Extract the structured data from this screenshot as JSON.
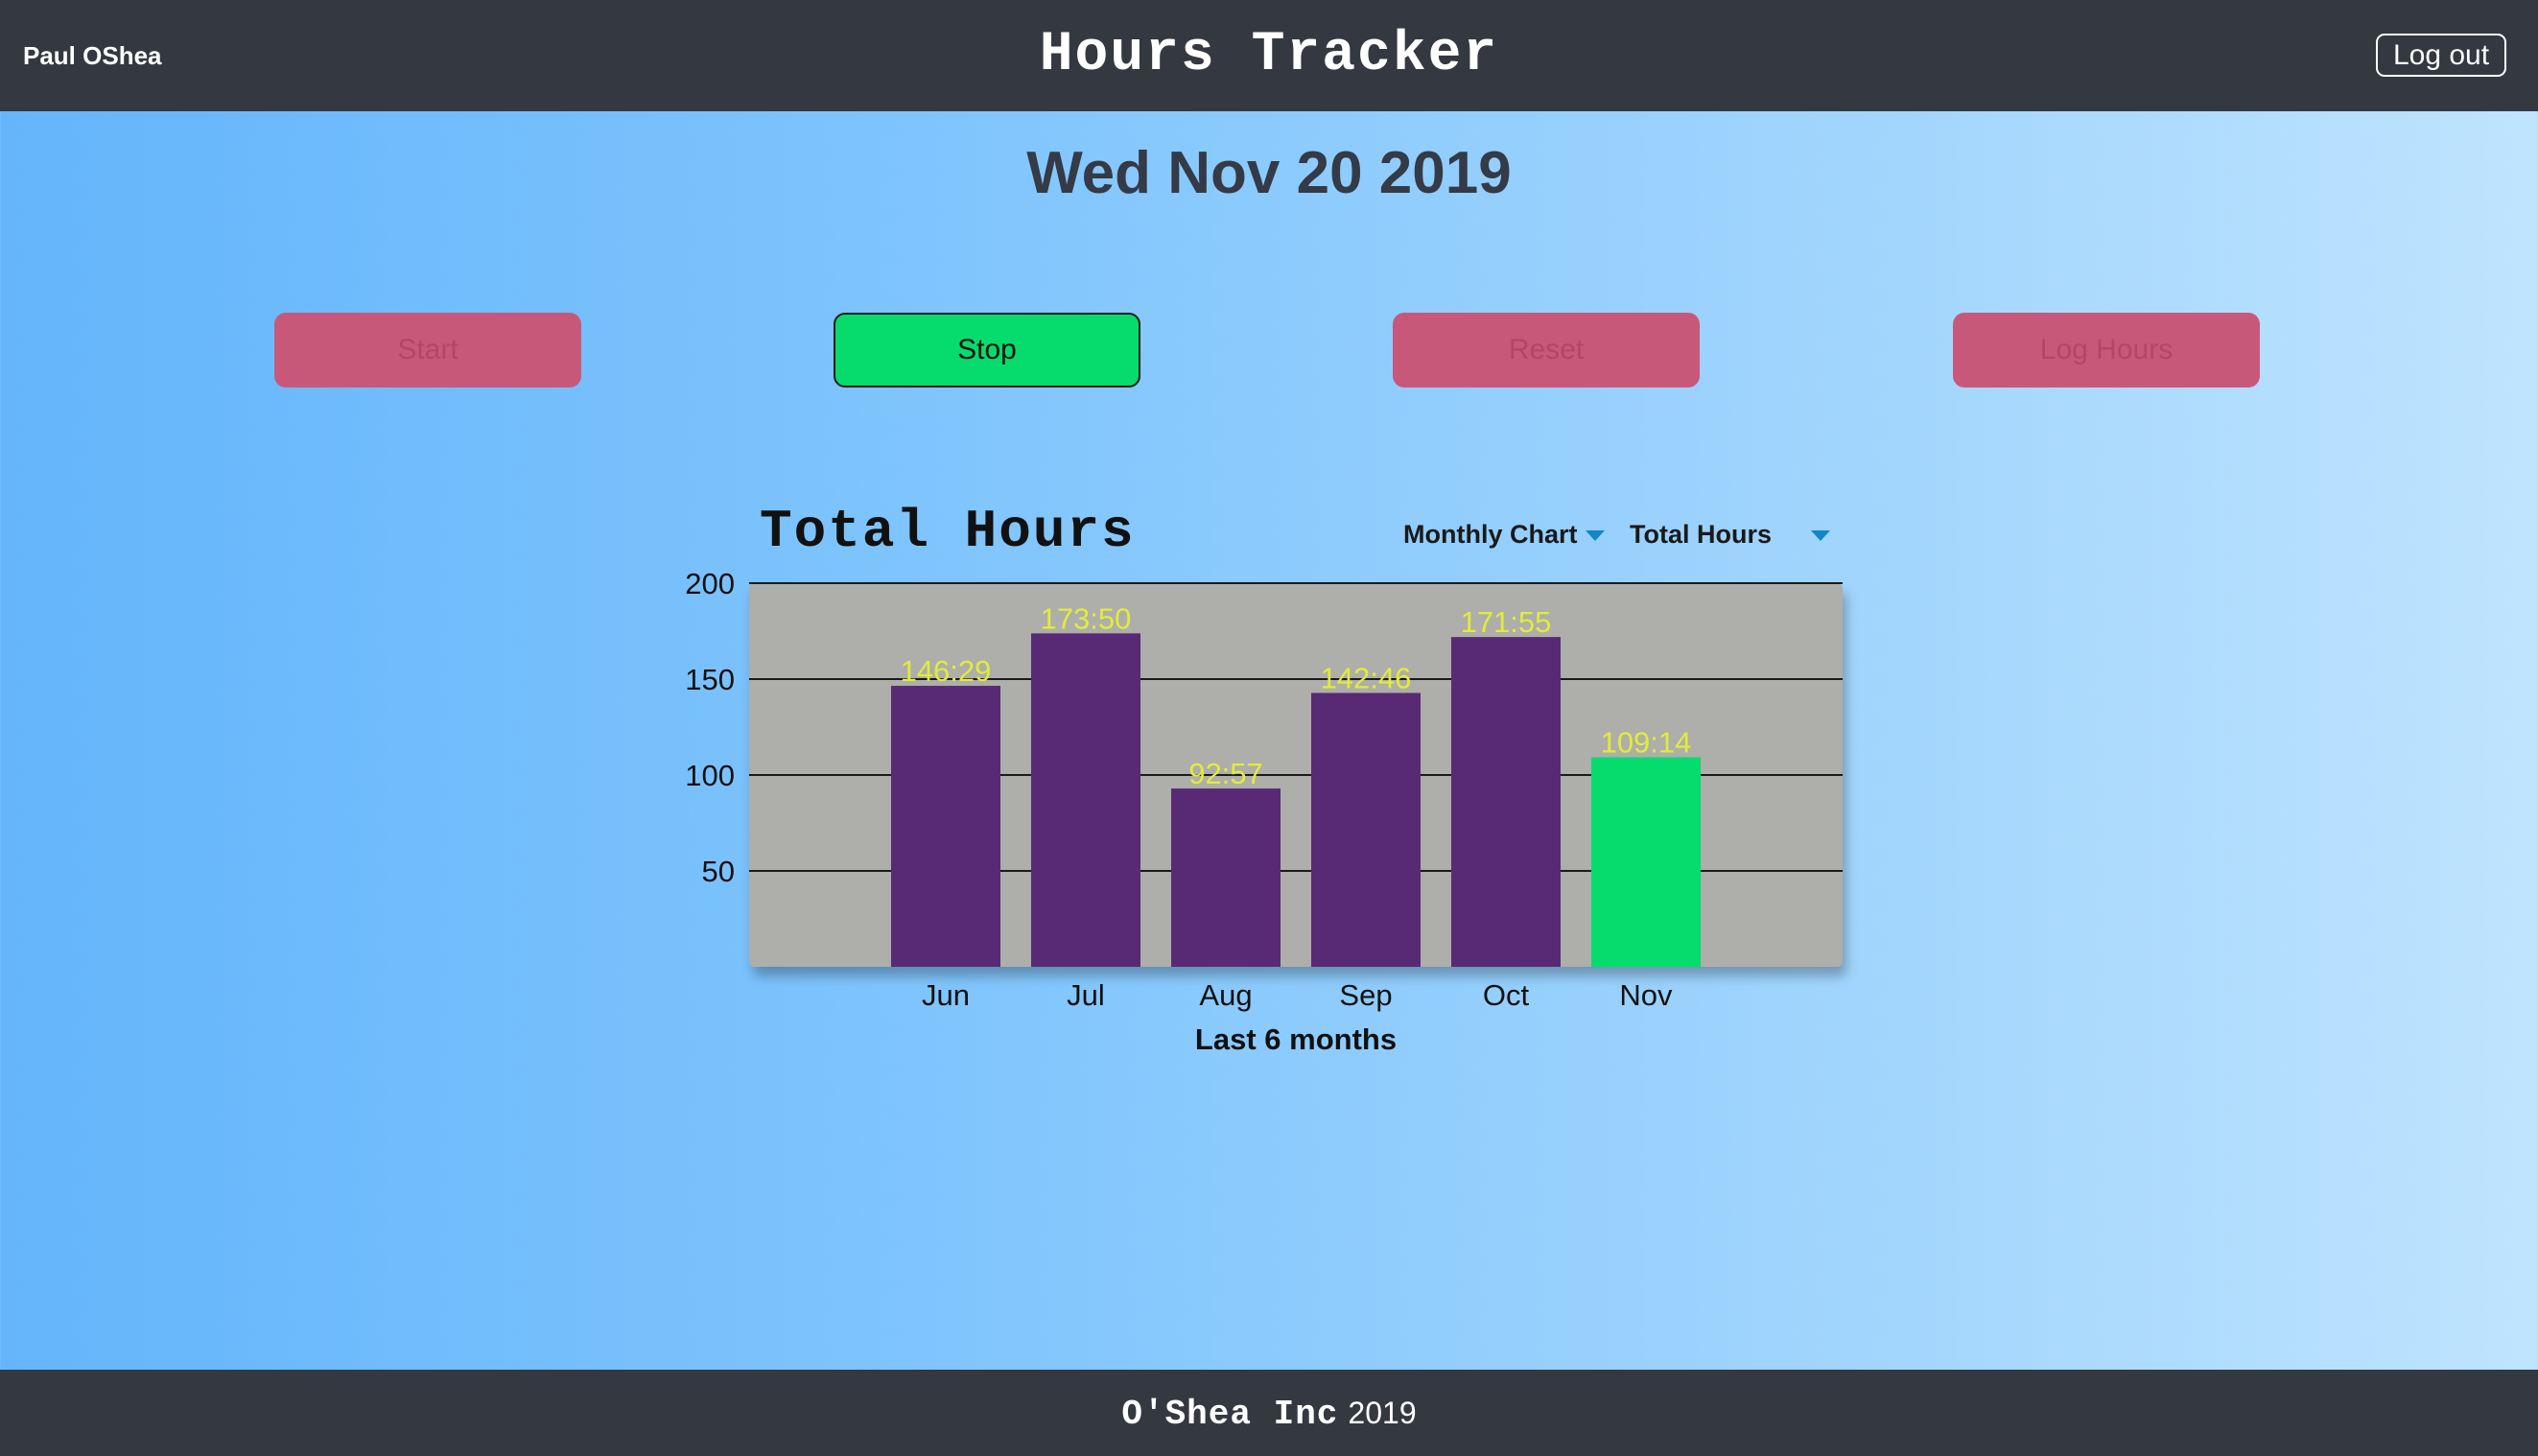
{
  "header": {
    "user_name": "Paul OShea",
    "title": "Hours Tracker",
    "logout_label": "Log out"
  },
  "date_display": "Wed Nov 20 2019",
  "controls": {
    "start_label": "Start",
    "stop_label": "Stop",
    "reset_label": "Reset",
    "log_hours_label": "Log Hours"
  },
  "chart_panel": {
    "title": "Total Hours",
    "chart_type_select": "Monthly Chart",
    "metric_select": "Total Hours"
  },
  "chart_data": {
    "type": "bar",
    "title": "Total Hours",
    "categories": [
      "Jun",
      "Jul",
      "Aug",
      "Sep",
      "Oct",
      "Nov"
    ],
    "values": [
      146.48,
      173.83,
      92.95,
      142.77,
      171.92,
      109.23
    ],
    "value_labels": [
      "146:29",
      "173:50",
      "92:57",
      "142:46",
      "171:55",
      "109:14"
    ],
    "xlabel": "Last 6 months",
    "ylabel": "",
    "ylim": [
      0,
      200
    ],
    "y_ticks": [
      50,
      100,
      150,
      200
    ],
    "grid": true,
    "colors": {
      "bar": "#582a75",
      "highlight_bar": "#05dc6d",
      "plot_background": "#aeaeaa",
      "value_label": "#e2ec3a"
    },
    "highlight_index": 5
  },
  "footer": {
    "company": "O'Shea Inc",
    "year": "2019"
  }
}
